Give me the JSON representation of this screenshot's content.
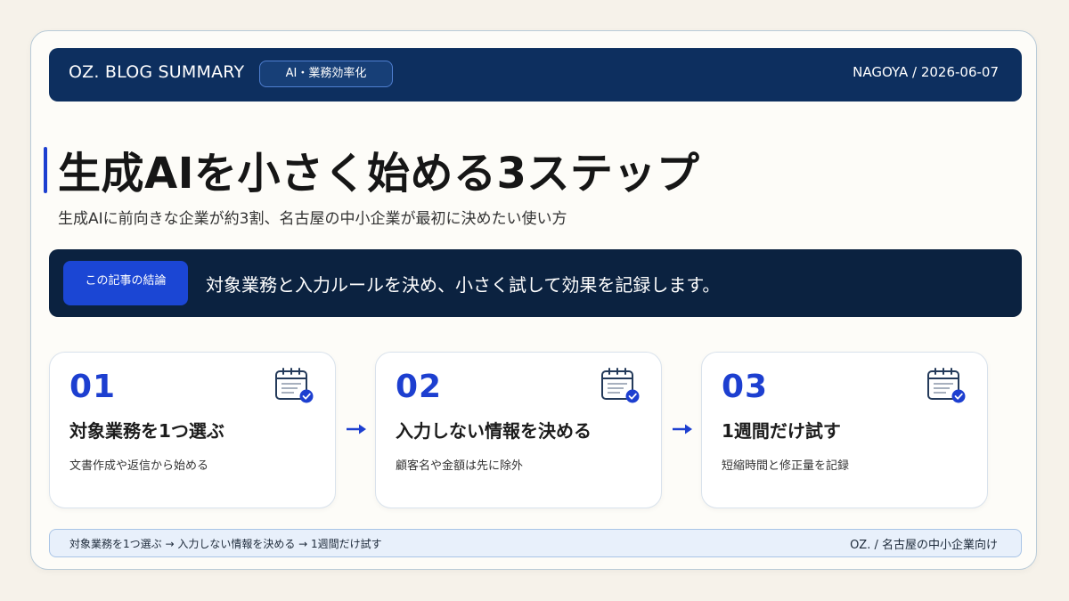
{
  "header": {
    "brand": "OZ. BLOG SUMMARY",
    "tag": "AI・業務効率化",
    "meta": "NAGOYA / 2026-06-07"
  },
  "title": "生成AIを小さく始める3ステップ",
  "subtitle": "生成AIに前向きな企業が約3割、名古屋の中小企業が最初に決めたい使い方",
  "conclusion": {
    "label": "この記事の結論",
    "text": "対象業務と入力ルールを決め、小さく試して効果を記録します。"
  },
  "steps": [
    {
      "number": "01",
      "title": "対象業務を1つ選ぶ",
      "description": "文書作成や返信から始める",
      "icon": "calendar-check-icon"
    },
    {
      "number": "02",
      "title": "入力しない情報を決める",
      "description": "顧客名や金額は先に除外",
      "icon": "calendar-check-icon"
    },
    {
      "number": "03",
      "title": "1週間だけ試す",
      "description": "短縮時間と修正量を記録",
      "icon": "calendar-check-icon"
    }
  ],
  "footer": {
    "flow": "対象業務を1つ選ぶ → 入力しない情報を決める → 1週間だけ試す",
    "credit": "OZ. / 名古屋の中小企業向け"
  },
  "colors": {
    "header_bg": "#0d2f5f",
    "conclusion_bg": "#0b2240",
    "accent": "#1d3fd0",
    "footer_bg": "#e8f0fb",
    "page_bg": "#f6f2ea"
  }
}
